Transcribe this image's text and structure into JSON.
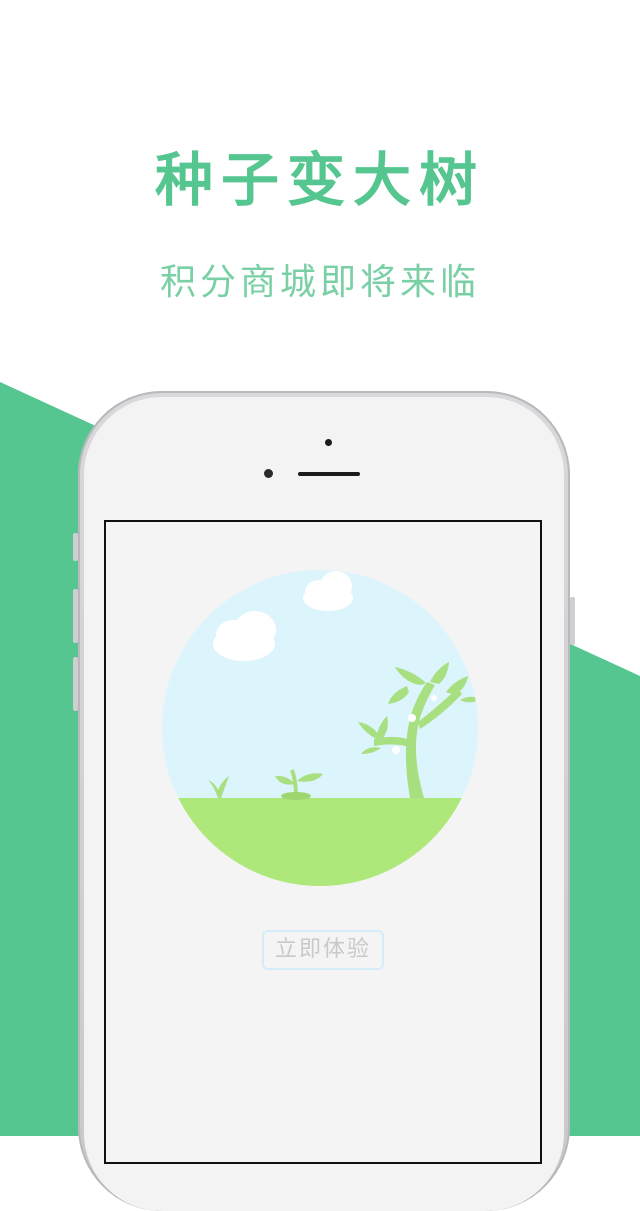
{
  "headline": "种子变大树",
  "subline": "积分商城即将来临",
  "screen": {
    "cta_label": "立即体验"
  },
  "colors": {
    "brand_green": "#55c68f",
    "subtitle_green": "#78d0a4",
    "sky": "#dcf4fb",
    "grass": "#aee77a",
    "plant": "#a8df80",
    "cta_border": "#d4ecfa"
  },
  "icons": {
    "cloud": "cloud-icon",
    "sprout": "sprout-icon",
    "tree": "tree-icon"
  }
}
